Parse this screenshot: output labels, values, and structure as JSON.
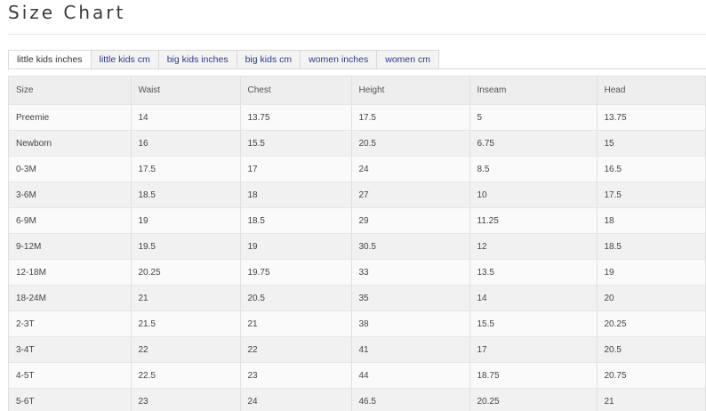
{
  "page": {
    "title": "Size Chart"
  },
  "tabs": [
    {
      "label": "little kids inches",
      "active": true
    },
    {
      "label": "little kids cm",
      "active": false
    },
    {
      "label": "big kids inches",
      "active": false
    },
    {
      "label": "big kids cm",
      "active": false
    },
    {
      "label": "women inches",
      "active": false
    },
    {
      "label": "women cm",
      "active": false
    }
  ],
  "colors": {
    "tab_link": "#2a3c8c",
    "header_bg": "#eeeeee",
    "row_odd": "#fafafa",
    "row_even": "#f1f1f1"
  },
  "table": {
    "columns": [
      "Size",
      "Waist",
      "Chest",
      "Height",
      "Inseam",
      "Head"
    ],
    "rows": [
      [
        "Preemie",
        "14",
        "13.75",
        "17.5",
        "5",
        "13.75"
      ],
      [
        "Newborn",
        "16",
        "15.5",
        "20.5",
        "6.75",
        "15"
      ],
      [
        "0-3M",
        "17.5",
        "17",
        "24",
        "8.5",
        "16.5"
      ],
      [
        "3-6M",
        "18.5",
        "18",
        "27",
        "10",
        "17.5"
      ],
      [
        "6-9M",
        "19",
        "18.5",
        "29",
        "11.25",
        "18"
      ],
      [
        "9-12M",
        "19.5",
        "19",
        "30.5",
        "12",
        "18.5"
      ],
      [
        "12-18M",
        "20.25",
        "19.75",
        "33",
        "13.5",
        "19"
      ],
      [
        "18-24M",
        "21",
        "20.5",
        "35",
        "14",
        "20"
      ],
      [
        "2-3T",
        "21.5",
        "21",
        "38",
        "15.5",
        "20.25"
      ],
      [
        "3-4T",
        "22",
        "22",
        "41",
        "17",
        "20.5"
      ],
      [
        "4-5T",
        "22.5",
        "23",
        "44",
        "18.75",
        "20.75"
      ],
      [
        "5-6T",
        "23",
        "24",
        "46.5",
        "20.25",
        "21"
      ]
    ]
  }
}
